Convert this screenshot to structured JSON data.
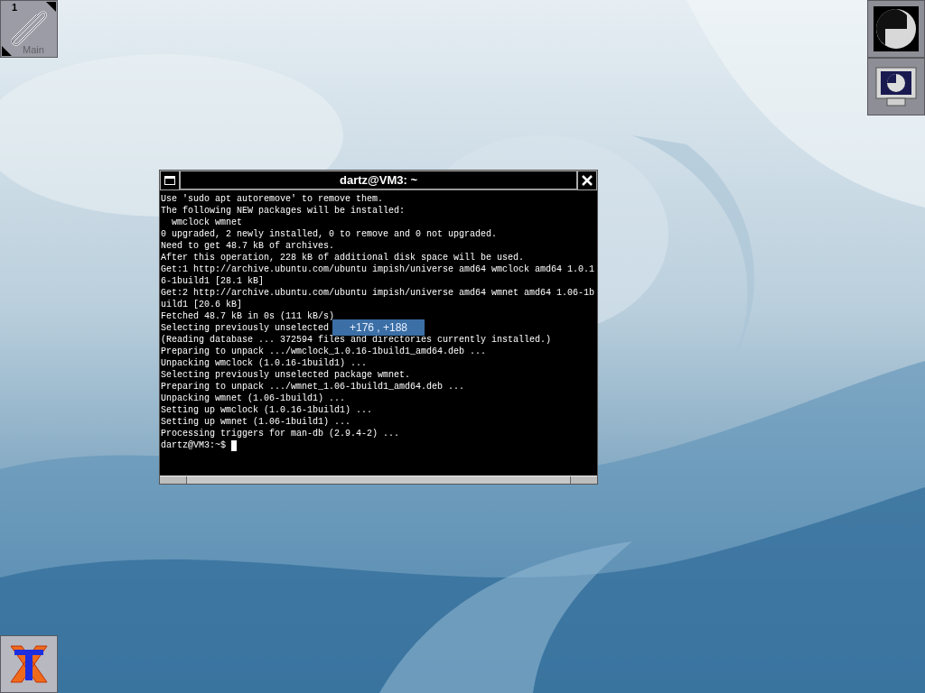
{
  "clip": {
    "workspace_number": "1",
    "workspace_name": "Main"
  },
  "terminal": {
    "title": "dartz@VM3: ~",
    "lines": [
      "Use 'sudo apt autoremove' to remove them.",
      "The following NEW packages will be installed:",
      "  wmclock wmnet",
      "0 upgraded, 2 newly installed, 0 to remove and 0 not upgraded.",
      "Need to get 48.7 kB of archives.",
      "After this operation, 228 kB of additional disk space will be used.",
      "Get:1 http://archive.ubuntu.com/ubuntu impish/universe amd64 wmclock amd64 1.0.1",
      "6-1build1 [28.1 kB]",
      "Get:2 http://archive.ubuntu.com/ubuntu impish/universe amd64 wmnet amd64 1.06-1b",
      "uild1 [20.6 kB]",
      "Fetched 48.7 kB in 0s (111 kB/s)",
      "Selecting previously unselected",
      "(Reading database ... 372594 files and directories currently installed.)",
      "Preparing to unpack .../wmclock_1.0.16-1build1_amd64.deb ...",
      "Unpacking wmclock (1.0.16-1build1) ...",
      "Selecting previously unselected package wmnet.",
      "Preparing to unpack .../wmnet_1.06-1build1_amd64.deb ...",
      "Unpacking wmnet (1.06-1build1) ...",
      "Setting up wmclock (1.0.16-1build1) ...",
      "Setting up wmnet (1.06-1build1) ...",
      "Processing triggers for man-db (2.9.4-2) ..."
    ],
    "prompt": "dartz@VM3:~$"
  },
  "geometry_tooltip": "+176 , +188"
}
